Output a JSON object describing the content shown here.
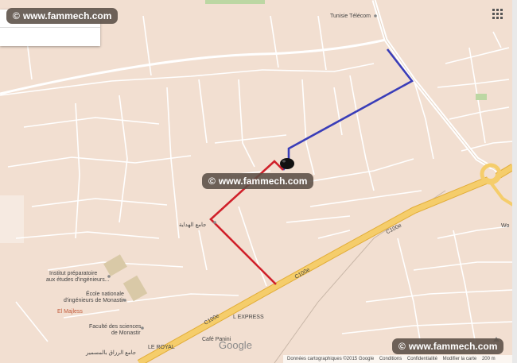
{
  "watermark": {
    "text": "www.fammech.com",
    "copyright_symbol": "©"
  },
  "labels": {
    "tunisie_telecom": "Tunisie Télécom",
    "mosque": "جامع الهداية",
    "institut_line1": "Institut préparatoire",
    "institut_line2": "aux études d'ingénieurs...",
    "ecole_line1": "École nationale",
    "ecole_line2": "d'ingénieurs de Monastir",
    "el_majless": "El Majless",
    "faculte_line1": "Faculté des sciences",
    "faculte_line2": "de Monastir",
    "mosque2": "جامع الرزاق بالمسمير",
    "le_royal": "LE ROYAL",
    "cafe_panini": "Café Panini",
    "express": "L EXPRESS",
    "road_c100e": "C100e",
    "wo": "Wo"
  },
  "google_logo": "Google",
  "footer": {
    "data": "Données cartographiques ©2015 Google",
    "conditions": "Conditions",
    "confidentialite": "Confidentialité",
    "modifier": "Modifier la carte",
    "scale": "200 m"
  },
  "colors": {
    "land": "#f2dfd1",
    "street": "#ffffff",
    "highway": "#f5cd6b",
    "highway_border": "#e2ad38",
    "route_blue": "#3a3db8",
    "route_red": "#d0202a",
    "watermark_bg": "#5a4e46",
    "park": "#d9c9a7"
  },
  "icons": {
    "apps": "apps-grid-icon",
    "marker": "location-marker-icon",
    "compass": "compass-icon"
  }
}
